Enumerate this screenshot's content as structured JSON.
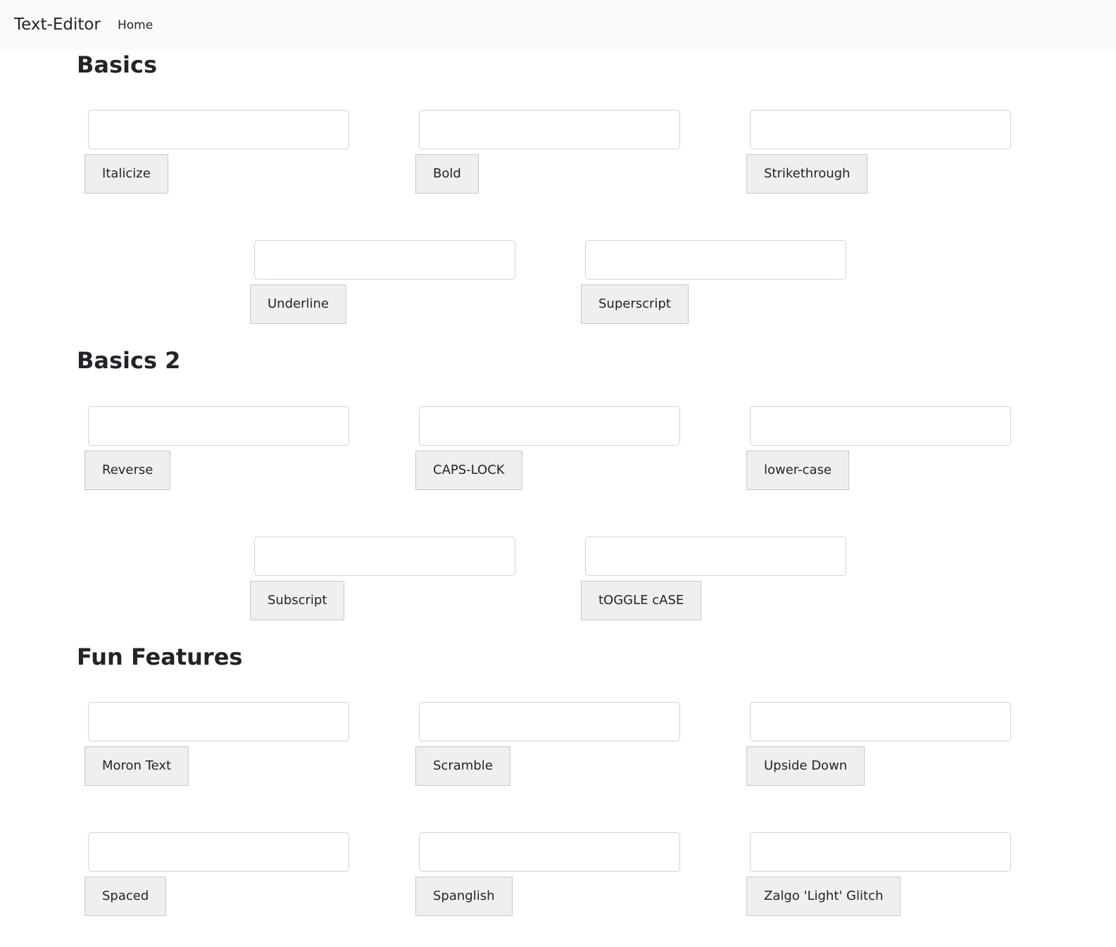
{
  "navbar": {
    "brand": "Text-Editor",
    "links": [
      {
        "label": "Home"
      }
    ]
  },
  "sections": [
    {
      "title": "Basics",
      "tools": [
        {
          "button": "Italicize",
          "value": "",
          "placeholder": ""
        },
        {
          "button": "Bold",
          "value": "",
          "placeholder": ""
        },
        {
          "button": "Strikethrough",
          "value": "",
          "placeholder": ""
        },
        {
          "button": "Underline",
          "value": "",
          "placeholder": ""
        },
        {
          "button": "Superscript",
          "value": "",
          "placeholder": ""
        }
      ]
    },
    {
      "title": "Basics 2",
      "tools": [
        {
          "button": "Reverse",
          "value": "",
          "placeholder": ""
        },
        {
          "button": "CAPS-LOCK",
          "value": "",
          "placeholder": ""
        },
        {
          "button": "lower-case",
          "value": "",
          "placeholder": ""
        },
        {
          "button": "Subscript",
          "value": "",
          "placeholder": ""
        },
        {
          "button": "tOGGLE cASE",
          "value": "",
          "placeholder": ""
        }
      ]
    },
    {
      "title": "Fun Features",
      "tools": [
        {
          "button": "Moron Text",
          "value": "",
          "placeholder": ""
        },
        {
          "button": "Scramble",
          "value": "",
          "placeholder": ""
        },
        {
          "button": "Upside Down",
          "value": "",
          "placeholder": ""
        },
        {
          "button": "Spaced",
          "value": "",
          "placeholder": ""
        },
        {
          "button": "Spanglish",
          "value": "",
          "placeholder": ""
        },
        {
          "button": "Zalgo 'Light' Glitch",
          "value": "",
          "placeholder": ""
        }
      ]
    }
  ]
}
